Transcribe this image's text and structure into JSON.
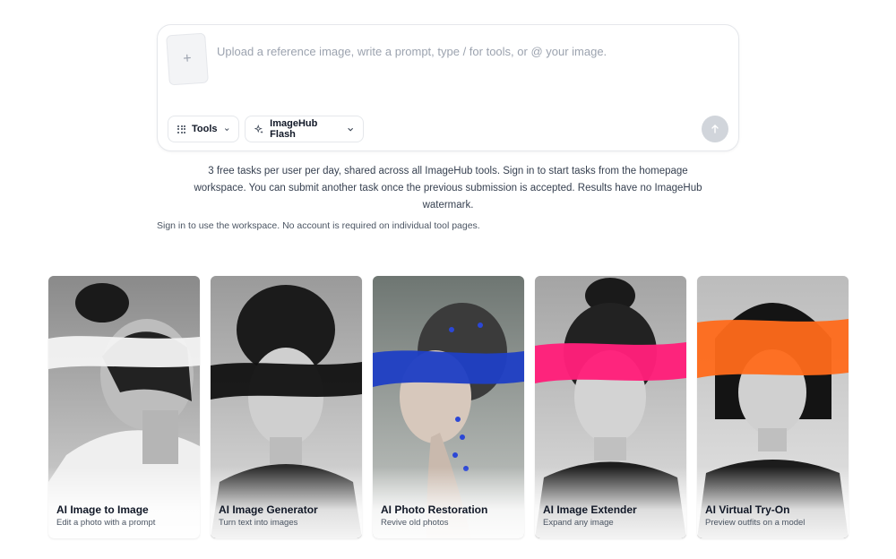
{
  "composer": {
    "upload_icon": "+",
    "prompt_placeholder": "Upload a reference image, write a prompt, type / for tools, or @ your image.",
    "tools_label": "Tools",
    "model_label": "ImageHub Flash",
    "send_icon": "arrow-up-icon"
  },
  "info": {
    "text": "3 free tasks per user per day, shared across all ImageHub tools. Sign in to start tasks from the homepage workspace. You can submit another task once the previous submission is accepted. Results have no ImageHub watermark.",
    "signin_note": "Sign in to use the workspace. No account is required on individual tool pages."
  },
  "cards": [
    {
      "title": "AI Image to Image",
      "subtitle": "Edit a photo with a prompt",
      "stroke_color": "#f2f2f2"
    },
    {
      "title": "AI Image Generator",
      "subtitle": "Turn text into images",
      "stroke_color": "#111111"
    },
    {
      "title": "AI Photo Restoration",
      "subtitle": "Revive old photos",
      "stroke_color": "#1f3fc4"
    },
    {
      "title": "AI Image Extender",
      "subtitle": "Expand any image",
      "stroke_color": "#ff1f7a"
    },
    {
      "title": "AI Virtual Try-On",
      "subtitle": "Preview outfits on a model",
      "stroke_color": "#ff6a1a"
    }
  ]
}
